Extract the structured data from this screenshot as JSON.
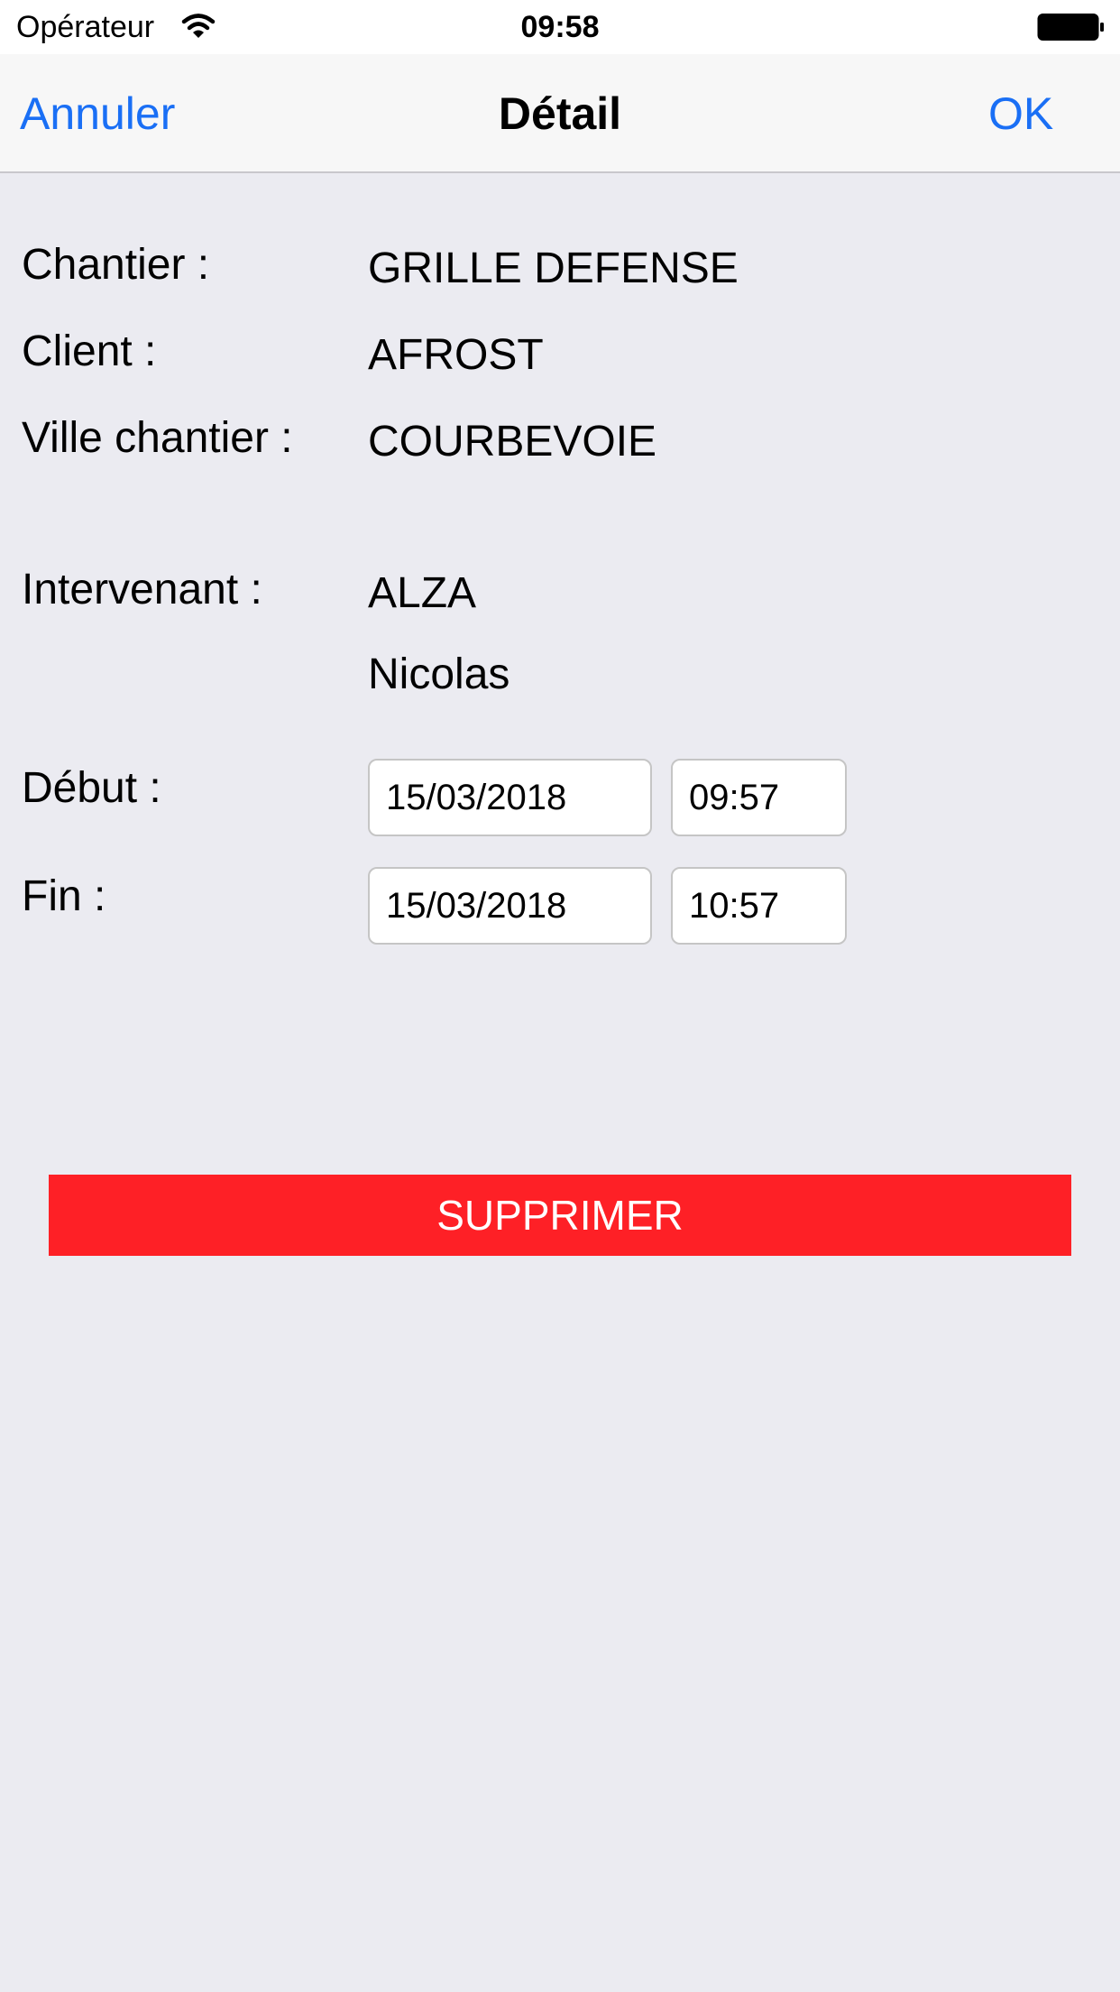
{
  "status_bar": {
    "carrier": "Opérateur",
    "time": "09:58"
  },
  "nav": {
    "cancel_label": "Annuler",
    "title": "Détail",
    "ok_label": "OK"
  },
  "details": {
    "chantier_label": "Chantier :",
    "chantier_value": "GRILLE DEFENSE",
    "client_label": "Client :",
    "client_value": "AFROST",
    "ville_label": "Ville chantier :",
    "ville_value": "COURBEVOIE",
    "intervenant_label": "Intervenant :",
    "intervenant_last": "ALZA",
    "intervenant_first": "Nicolas"
  },
  "schedule": {
    "debut_label": "Début :",
    "debut_date": "15/03/2018",
    "debut_time": "09:57",
    "fin_label": "Fin :",
    "fin_date": "15/03/2018",
    "fin_time": "10:57"
  },
  "actions": {
    "delete_label": "SUPPRIMER"
  },
  "colors": {
    "accent": "#1a6ff5",
    "danger": "#fe2026",
    "background": "#ebebf1"
  }
}
